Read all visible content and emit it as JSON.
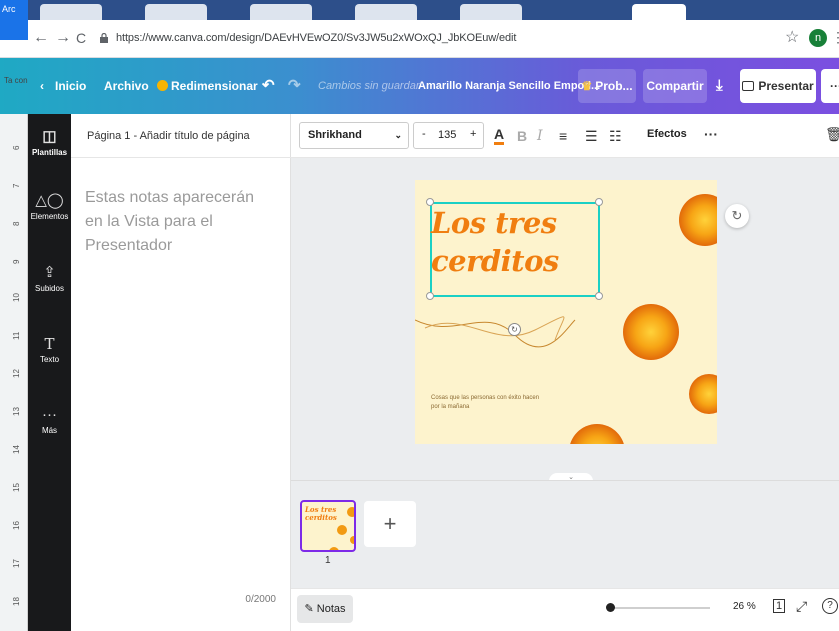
{
  "browser": {
    "url": "https://www.canva.com/design/DAEvHVEwOZ0/Sv3JW5u2xWOxQJ_JbKOEuw/edit",
    "profile_initial": "n",
    "overlay_label": "Arc",
    "overlay_side_text": "Ta con"
  },
  "topbar": {
    "home_label": "Inicio",
    "file_label": "Archivo",
    "resize_label": "Redimensionar",
    "status_label": "Cambios sin guardar",
    "doc_title": "Amarillo Naranja Sencillo Empod...",
    "pro_label": "Prob...",
    "share_label": "Compartir",
    "present_label": "Presentar",
    "more_label": "···"
  },
  "sidenav": {
    "items": [
      {
        "label": "Plantillas",
        "icon": "templates-icon"
      },
      {
        "label": "Elementos",
        "icon": "elements-icon"
      },
      {
        "label": "Subidos",
        "icon": "uploads-icon"
      },
      {
        "label": "Texto",
        "icon": "text-icon"
      },
      {
        "label": "Más",
        "icon": "more-icon"
      }
    ]
  },
  "notes": {
    "header": "Página 1 - Añadir título de página",
    "placeholder": "Estas notas aparecerán en la Vista para el Presentador",
    "count": "0/2000"
  },
  "toolbar": {
    "font": "Shrikhand",
    "size": "135",
    "minus": "-",
    "plus": "+",
    "effects_label": "Efectos",
    "more_label": "···"
  },
  "design": {
    "title_line1": "Los tres",
    "title_line2": "cerditos",
    "subtitle": "Cosas que las personas con éxito hacen por la mañana",
    "title_color": "#f07e10",
    "bg_color": "#fdf3cd"
  },
  "pages": {
    "thumb_title": "Los tres cerditos",
    "page_number": "1",
    "add_label": "+"
  },
  "bottombar": {
    "notes_label": "Notas",
    "zoom": "26 %",
    "page_count_icon": "1"
  },
  "ruler_labels": [
    "6",
    "7",
    "8",
    "9",
    "10",
    "11",
    "12",
    "13",
    "14",
    "15",
    "16",
    "17",
    "18"
  ]
}
